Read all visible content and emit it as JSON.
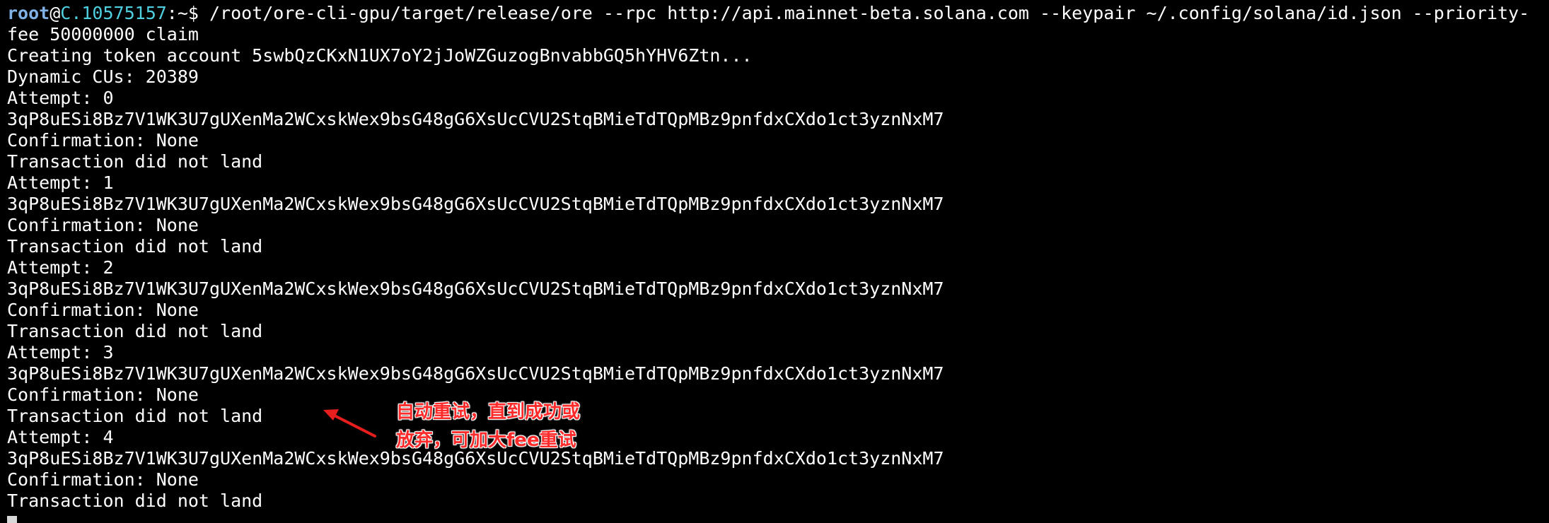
{
  "prompt": {
    "user": "root",
    "at": "@",
    "host": "C.10575157",
    "path": ":~$"
  },
  "command_first": " /root/ore-cli-gpu/target/release/ore --rpc http://api.mainnet-beta.solana.com --keypair ~/.config/solana/id.json --priority-",
  "output_lines": [
    "fee 50000000 claim",
    "Creating token account 5swbQzCKxN1UX7oY2jJoWZGuzogBnvabbGQ5hYHV6Ztn...",
    "Dynamic CUs: 20389",
    "Attempt: 0",
    "3qP8uESi8Bz7V1WK3U7gUXenMa2WCxskWex9bsG48gG6XsUcCVU2StqBMieTdTQpMBz9pnfdxCXdo1ct3yznNxM7",
    "Confirmation: None",
    "Transaction did not land",
    "Attempt: 1",
    "3qP8uESi8Bz7V1WK3U7gUXenMa2WCxskWex9bsG48gG6XsUcCVU2StqBMieTdTQpMBz9pnfdxCXdo1ct3yznNxM7",
    "Confirmation: None",
    "Transaction did not land",
    "Attempt: 2",
    "3qP8uESi8Bz7V1WK3U7gUXenMa2WCxskWex9bsG48gG6XsUcCVU2StqBMieTdTQpMBz9pnfdxCXdo1ct3yznNxM7",
    "Confirmation: None",
    "Transaction did not land",
    "Attempt: 3",
    "3qP8uESi8Bz7V1WK3U7gUXenMa2WCxskWex9bsG48gG6XsUcCVU2StqBMieTdTQpMBz9pnfdxCXdo1ct3yznNxM7",
    "Confirmation: None",
    "Transaction did not land",
    "Attempt: 4",
    "3qP8uESi8Bz7V1WK3U7gUXenMa2WCxskWex9bsG48gG6XsUcCVU2StqBMieTdTQpMBz9pnfdxCXdo1ct3yznNxM7",
    "Confirmation: None",
    "Transaction did not land"
  ],
  "annotation": {
    "line1": "自动重试，直到成功或",
    "line2": "放弃，可加大fee重试",
    "color": "#ff2a2a"
  },
  "icons": {
    "annotation_arrow": "arrow-icon",
    "cursor": "block-cursor"
  },
  "colors": {
    "background": "#000000",
    "text": "#ffffff",
    "prompt_user": "#7fb0e6",
    "prompt_host": "#4fd0e0"
  }
}
